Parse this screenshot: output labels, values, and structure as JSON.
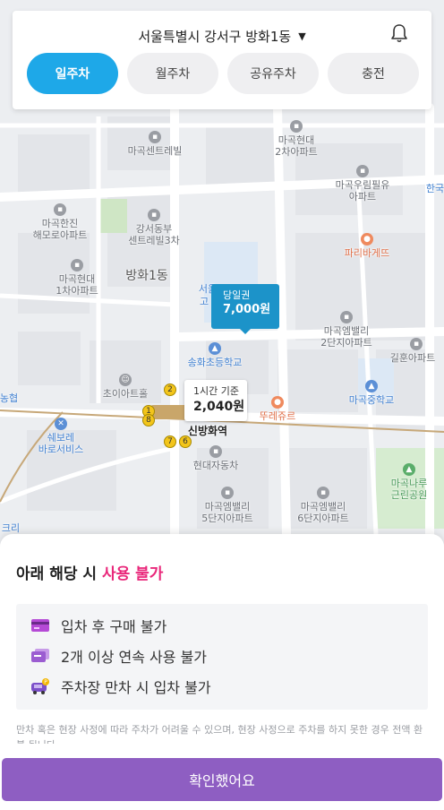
{
  "header": {
    "location": "서울특별시 강서구 방화1동",
    "tabs": [
      {
        "label": "일주차",
        "active": true
      },
      {
        "label": "월주차",
        "active": false
      },
      {
        "label": "공유주차",
        "active": false
      },
      {
        "label": "충전",
        "active": false
      }
    ]
  },
  "map": {
    "labels": {
      "magok_central": "마곡센트레빌",
      "magok_hyundai2": "마곡현대\n2차아파트",
      "magok_woorim": "마곡우림필유\n아파트",
      "hanjin": "마곡한진\n해모로아파트",
      "gangseo_central3": "강서동부\n센트레빌3차",
      "magok_hyundai1": "마곡현대\n1차아파트",
      "banghwa1": "방화1동",
      "paris": "파리바게뜨",
      "emvalley2": "마곡엠밸리\n2단지아파트",
      "songhwa": "송화초등학교",
      "gilhun": "길훈아파트",
      "magok_middle": "마곡중학교",
      "choi_art": "초이아트홀",
      "touslesjours": "뚜레쥬르",
      "sinbanghwa": "신방화역",
      "hyundai_motors": "현대자동차",
      "swebore": "쉐보레\n바로서비스",
      "nonghyup": "농협",
      "emvalley5": "마곡엠밸리\n5단지아파트",
      "emvalley6": "마곡엠밸리\n6단지아파트",
      "magok_naru": "마곡나루\n근린공원",
      "hanguk": "한국",
      "seo": "서울",
      "go": "고",
      "clinic": "크리"
    },
    "subway_lines": [
      "2",
      "1",
      "8",
      "7",
      "6"
    ],
    "markers": {
      "daily": {
        "kind": "당일권",
        "price": "7,000원"
      },
      "hourly": {
        "kind": "1시간 기준",
        "price": "2,040원"
      }
    }
  },
  "sheet": {
    "title_prefix": "아래 해당 시 ",
    "title_highlight": "사용 불가",
    "notices": [
      {
        "icon": "credit-card-icon",
        "text": "입차 후 구매 불가"
      },
      {
        "icon": "ticket-icon",
        "text": "2개 이상 연속 사용 불가"
      },
      {
        "icon": "parking-car-icon",
        "text": "주차장 만차 시 입차 불가"
      }
    ],
    "fine_print": "만차 혹은 현장 사정에 따라 주차가 어려울 수 있으며, 현장 사정으로 주차를 하지 못한 경우 전액 환불 됩니다.",
    "confirm_label": "확인했어요"
  },
  "colors": {
    "accent": "#1ea8e8",
    "highlight": "#e9277a",
    "confirm": "#8e5ec2",
    "marker": "#1c93c9"
  }
}
